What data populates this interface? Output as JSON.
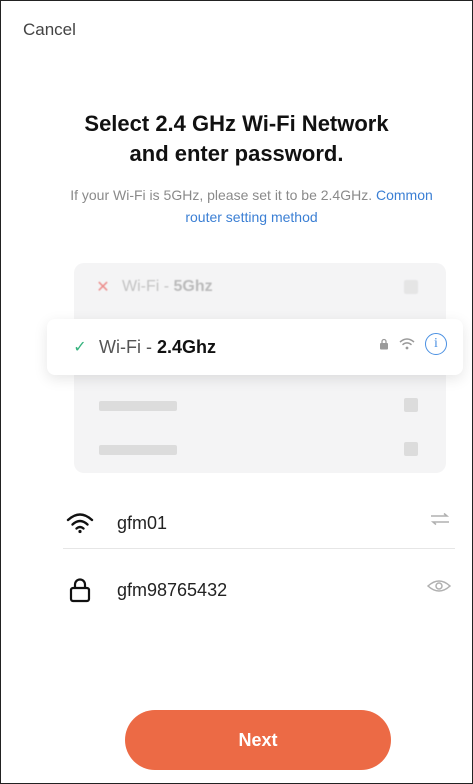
{
  "header": {
    "cancel_label": "Cancel"
  },
  "title": {
    "line1": "Select 2.4 GHz Wi-Fi Network",
    "line2": "and enter password."
  },
  "subtitle": {
    "text": "If your Wi-Fi is 5GHz, please set it to be 2.4GHz.",
    "link": "Common router setting method"
  },
  "network_list": {
    "bad_example": {
      "prefix": "Wi-Fi - ",
      "band": "5Ghz",
      "status": "x-mark"
    },
    "good_example": {
      "prefix": "Wi-Fi - ",
      "band": "2.4Ghz",
      "status": "check-mark"
    }
  },
  "form": {
    "ssid_value": "gfm01",
    "password_value": "gfm98765432"
  },
  "next_label": "Next",
  "colors": {
    "accent": "#ec6a45",
    "link": "#3b7fd4",
    "check": "#36b37e",
    "cross": "#e53935",
    "info": "#4a90e2"
  },
  "icons": [
    "wifi-icon",
    "lock-icon",
    "switch-network-icon",
    "eye-icon",
    "info-icon",
    "check-icon",
    "x-icon"
  ]
}
